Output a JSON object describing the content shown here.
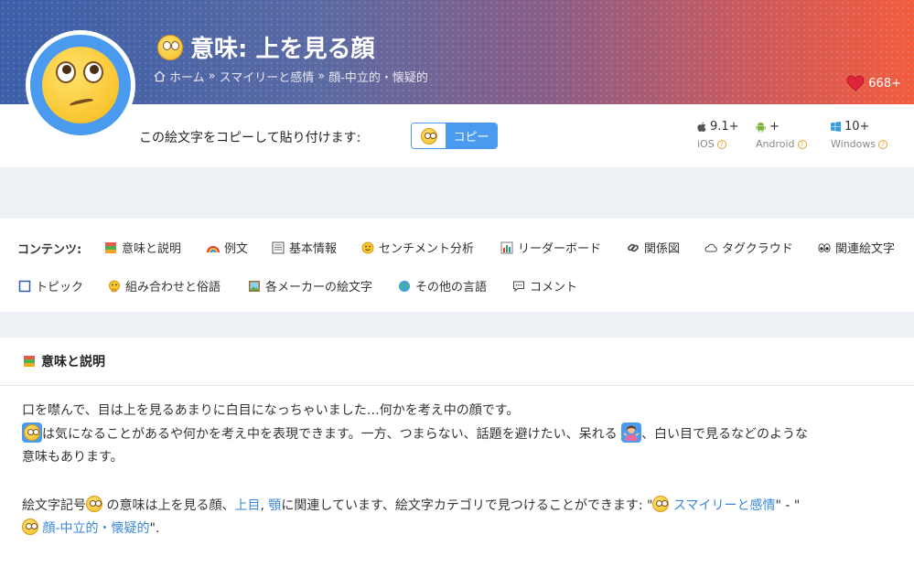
{
  "header": {
    "title": "意味: 上を見る顔",
    "breadcrumb": [
      "ホーム",
      "スマイリーと感情",
      "顔-中立的・懐疑的"
    ],
    "likes": "668+"
  },
  "copy": {
    "prompt": "この絵文字をコピーして貼り付けます:",
    "button_label": "コピー"
  },
  "platforms": [
    {
      "version": "9.1+",
      "name": "iOS",
      "icon": "apple-icon"
    },
    {
      "version": "+",
      "name": "Android",
      "icon": "android-icon"
    },
    {
      "version": "10+",
      "name": "Windows",
      "icon": "windows-icon"
    }
  ],
  "contents": {
    "label": "コンテンツ:",
    "items": [
      "意味と説明",
      "例文",
      "基本情報",
      "センチメント分析",
      "リーダーボード",
      "関係図",
      "タグクラウド",
      "関連絵文字",
      "トピック",
      "組み合わせと俗語",
      "各メーカーの絵文字",
      "その他の言語",
      "コメント"
    ]
  },
  "section": {
    "title": "意味と説明",
    "p1_line1": "口を噤んで、目は上を見るあまりに白目になっちゃいました…何かを考え中の顔です。",
    "p1_line2a": "は気になることがあるや何かを考え中を表現できます。一方、つまらない、話題を避けたい、呆れる",
    "p1_line2b": "、白い目で見るなどのような",
    "p1_line3": "意味もあります。",
    "p2_a": "絵文字記号",
    "p2_b": "の意味は上を見る顔、",
    "p2_link1": "上目",
    "p2_sep": ", ",
    "p2_link2": "顎",
    "p2_c": "に関連しています、絵文字カテゴリで見つけることができます: \"",
    "p2_link3": "スマイリーと感情",
    "p2_d": "\" - \"",
    "p2_link4": "顔-中立的・懐疑的",
    "p2_e": "\"."
  },
  "colors": {
    "accent": "#4a9bf0",
    "heart": "#e0243b",
    "link": "#3a86d8"
  }
}
